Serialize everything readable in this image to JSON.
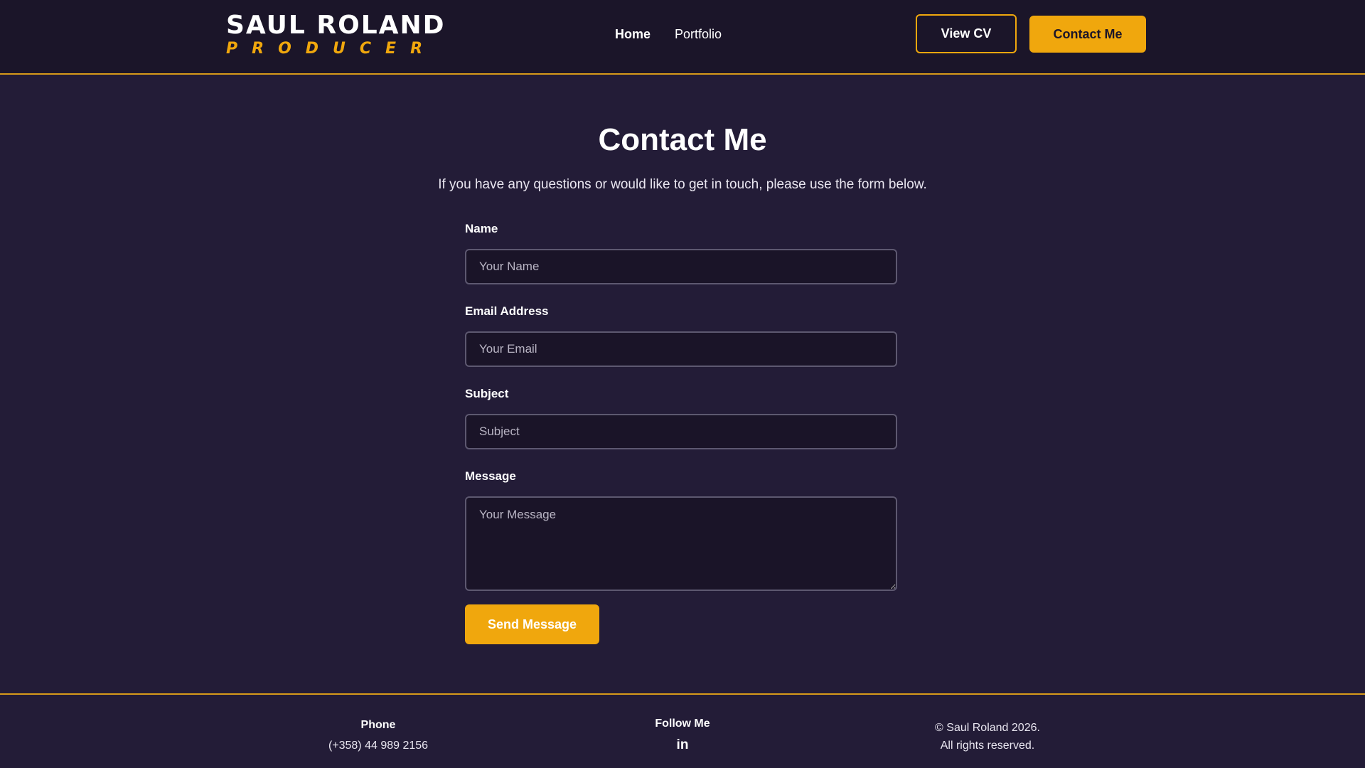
{
  "header": {
    "logo_name": "SAUL ROLAND",
    "logo_sub": "PRODUCER",
    "nav": [
      {
        "label": "Home"
      },
      {
        "label": "Portfolio"
      }
    ],
    "view_cv_label": "View CV",
    "contact_label": "Contact Me"
  },
  "main": {
    "title": "Contact Me",
    "subtitle": "If you have any questions or would like to get in touch, please use the form below.",
    "form": {
      "name": {
        "label": "Name",
        "placeholder": "Your Name"
      },
      "email": {
        "label": "Email Address",
        "placeholder": "Your Email"
      },
      "subject": {
        "label": "Subject",
        "placeholder": "Subject"
      },
      "message": {
        "label": "Message",
        "placeholder": "Your Message"
      },
      "submit_label": "Send Message"
    }
  },
  "footer": {
    "phone_heading": "Phone",
    "phone_value": "(+358) 44 989 2156",
    "follow_heading": "Follow Me",
    "linkedin_glyph": "in",
    "copyright_line1": "© Saul Roland 2026.",
    "copyright_line2": "All rights reserved."
  },
  "colors": {
    "accent": "#f0a70d",
    "header_bg": "#1b1529",
    "page_bg": "#231c37",
    "input_bg": "#1a1428"
  },
  "icons": {
    "social": "linkedin-icon"
  }
}
